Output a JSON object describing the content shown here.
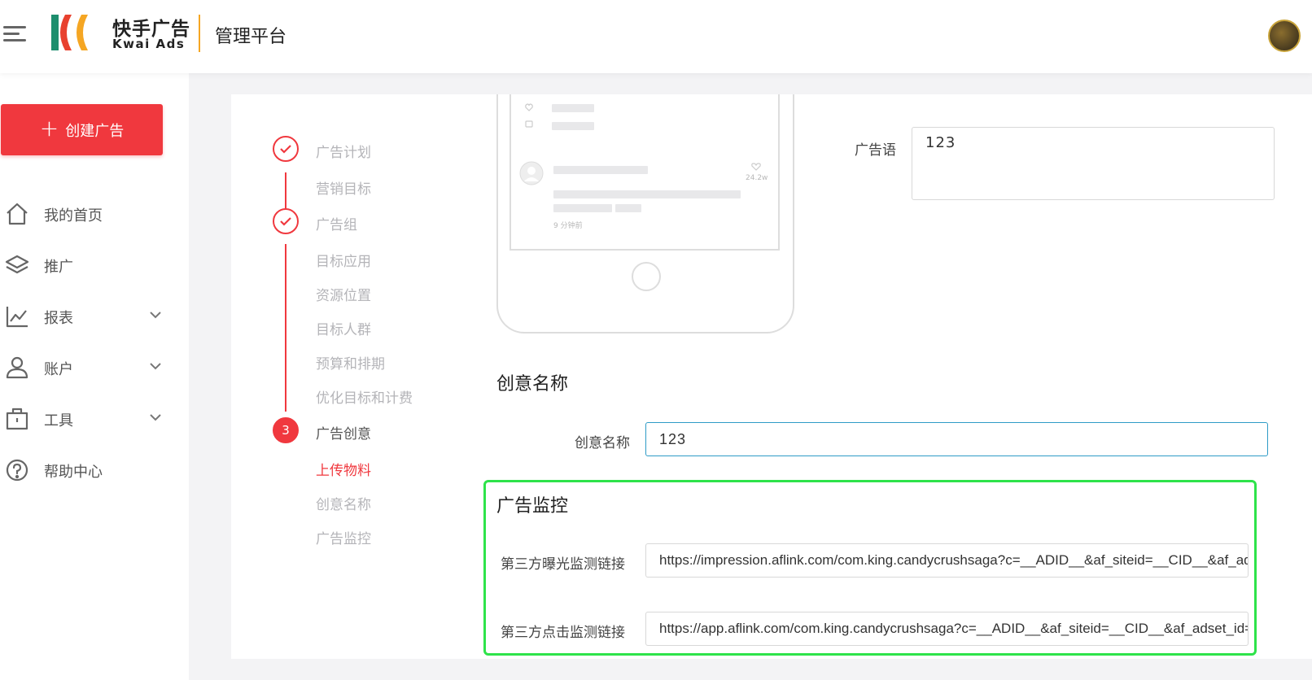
{
  "header": {
    "brand_cn": "快手广告",
    "brand_en": "Kwai Ads",
    "platform_title": "管理平台",
    "colors": {
      "logo_green": "#1d8e6d",
      "logo_red": "#e8412f",
      "logo_orange": "#f5a623"
    }
  },
  "sidebar": {
    "create_button": "创建广告",
    "items": [
      {
        "label": "我的首页",
        "icon": "home-icon"
      },
      {
        "label": "推广",
        "icon": "layers-icon"
      },
      {
        "label": "报表",
        "icon": "chart-icon",
        "expandable": true
      },
      {
        "label": "账户",
        "icon": "user-icon",
        "expandable": true
      },
      {
        "label": "工具",
        "icon": "toolbox-icon",
        "expandable": true
      },
      {
        "label": "帮助中心",
        "icon": "help-icon"
      }
    ]
  },
  "steps": {
    "items": [
      {
        "label": "广告计划",
        "type": "step",
        "state": "done"
      },
      {
        "label": "营销目标",
        "type": "sub"
      },
      {
        "label": "广告组",
        "type": "step",
        "state": "done"
      },
      {
        "label": "目标应用",
        "type": "sub"
      },
      {
        "label": "资源位置",
        "type": "sub"
      },
      {
        "label": "目标人群",
        "type": "sub"
      },
      {
        "label": "预算和排期",
        "type": "sub"
      },
      {
        "label": "优化目标和计费",
        "type": "sub"
      },
      {
        "label": "广告创意",
        "type": "step",
        "state": "current",
        "number": "3"
      },
      {
        "label": "上传物料",
        "type": "sub",
        "state": "current"
      },
      {
        "label": "创意名称",
        "type": "sub"
      },
      {
        "label": "广告监控",
        "type": "sub"
      }
    ]
  },
  "preview": {
    "likes": "24.2w",
    "time": "9 分钟前"
  },
  "form": {
    "ad_copy_label": "广告语",
    "ad_copy_value": "123",
    "creative_section_title": "创意名称",
    "creative_name_label": "创意名称",
    "creative_name_value": "123",
    "monitor_section_title": "广告监控",
    "impression_label": "第三方曝光监测链接",
    "impression_value": "https://impression.aflink.com/com.king.candycrushsaga?c=__ADID__&af_siteid=__CID__&af_adset_id=__AID__",
    "click_label": "第三方点击监测链接",
    "click_value": "https://app.aflink.com/com.king.candycrushsaga?c=__ADID__&af_siteid=__CID__&af_adset_id=__AID__"
  }
}
